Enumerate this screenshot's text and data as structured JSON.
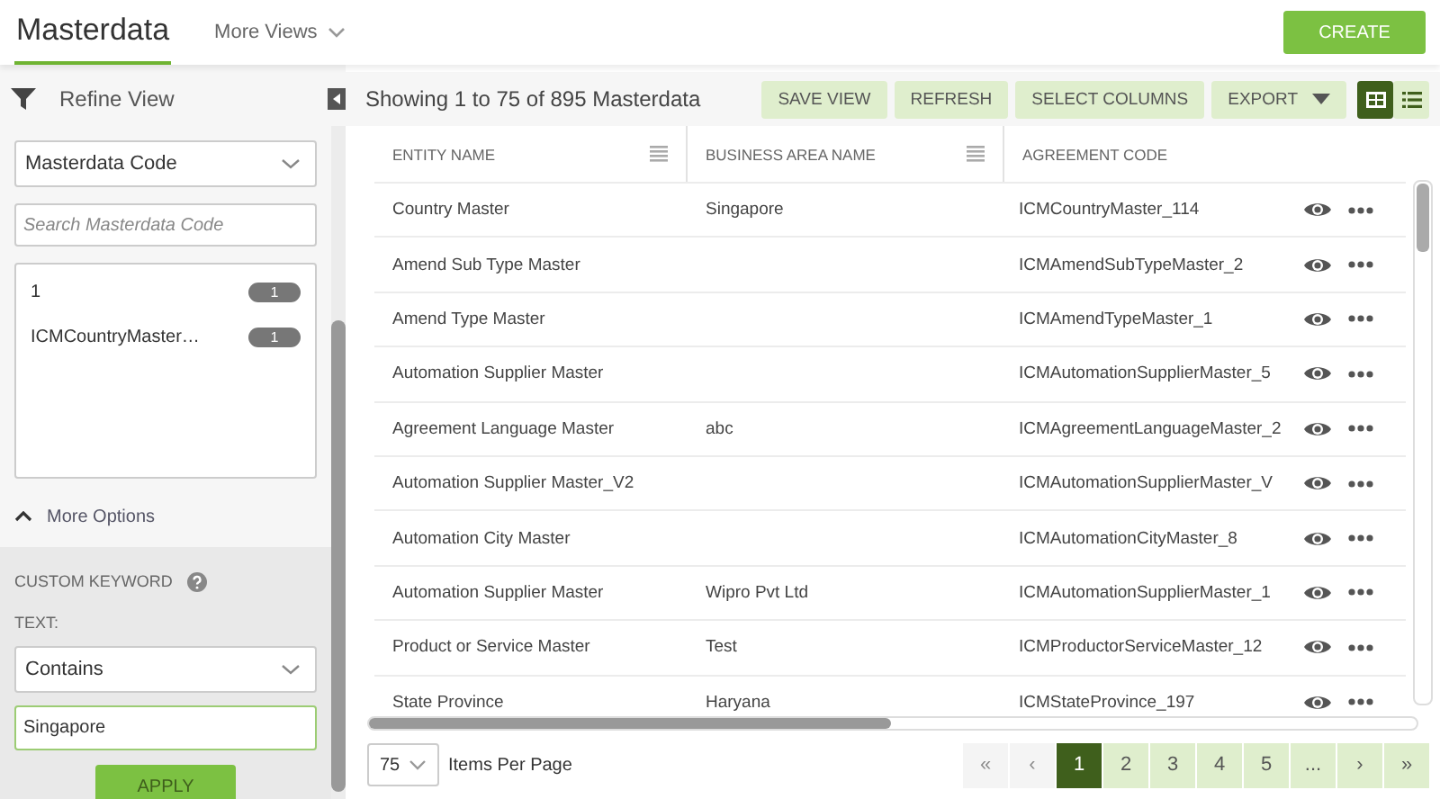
{
  "header": {
    "title": "Masterdata",
    "more_views": "More Views",
    "create": "CREATE"
  },
  "sidebar": {
    "title": "Refine View",
    "field_select": "Masterdata Code",
    "search_placeholder": "Search Masterdata Code",
    "values": [
      {
        "label": "1",
        "count": "1"
      },
      {
        "label": "ICMCountryMaster…",
        "count": "1"
      }
    ],
    "more_options": {
      "label": "More Options",
      "expanded": true
    },
    "custom_keyword": {
      "title": "CUSTOM KEYWORD",
      "text_label": "TEXT:",
      "operator": "Contains",
      "value": "Singapore",
      "apply": "APPLY"
    }
  },
  "toolbar": {
    "summary": "Showing 1 to 75 of 895 Masterdata",
    "buttons": [
      "SAVE VIEW",
      "REFRESH",
      "SELECT COLUMNS"
    ],
    "export": "EXPORT",
    "view_toggle": [
      {
        "kind": "grid",
        "selected": true
      },
      {
        "kind": "list",
        "selected": false
      }
    ]
  },
  "table": {
    "columns": [
      {
        "label": "ENTITY NAME",
        "has_menu": true
      },
      {
        "label": "BUSINESS AREA NAME",
        "has_menu": true
      },
      {
        "label": "AGREEMENT CODE",
        "has_menu": false
      }
    ],
    "rows": [
      [
        "Country Master",
        "Singapore",
        "ICMCountryMaster_114"
      ],
      [
        "Amend Sub Type Master",
        "",
        "ICMAmendSubTypeMaster_2"
      ],
      [
        "Amend Type Master",
        "",
        "ICMAmendTypeMaster_1"
      ],
      [
        "Automation Supplier Master",
        "",
        "ICMAutomationSupplierMaster_5"
      ],
      [
        "Agreement Language Master",
        "abc",
        "ICMAgreementLanguageMaster_2"
      ],
      [
        "Automation Supplier Master_V2",
        "",
        "ICMAutomationSupplierMaster_V"
      ],
      [
        "Automation City Master",
        "",
        "ICMAutomationCityMaster_8"
      ],
      [
        "Automation Supplier Master",
        "Wipro Pvt Ltd",
        "ICMAutomationSupplierMaster_1"
      ],
      [
        "Product or Service Master",
        "Test",
        "ICMProductorServiceMaster_12"
      ],
      [
        "State Province",
        "Haryana",
        "ICMStateProvince_197"
      ]
    ]
  },
  "footer": {
    "page_size": "75",
    "page_size_label": "Items Per Page",
    "pages": [
      {
        "label": "«",
        "selected": false,
        "disabled": true
      },
      {
        "label": "‹",
        "selected": false,
        "disabled": true
      },
      {
        "label": "1",
        "selected": true,
        "disabled": false
      },
      {
        "label": "2",
        "selected": false,
        "disabled": false
      },
      {
        "label": "3",
        "selected": false,
        "disabled": false
      },
      {
        "label": "4",
        "selected": false,
        "disabled": false
      },
      {
        "label": "5",
        "selected": false,
        "disabled": false
      },
      {
        "label": "...",
        "selected": false,
        "disabled": false
      },
      {
        "label": "›",
        "selected": false,
        "disabled": false
      },
      {
        "label": "»",
        "selected": false,
        "disabled": false
      }
    ]
  }
}
